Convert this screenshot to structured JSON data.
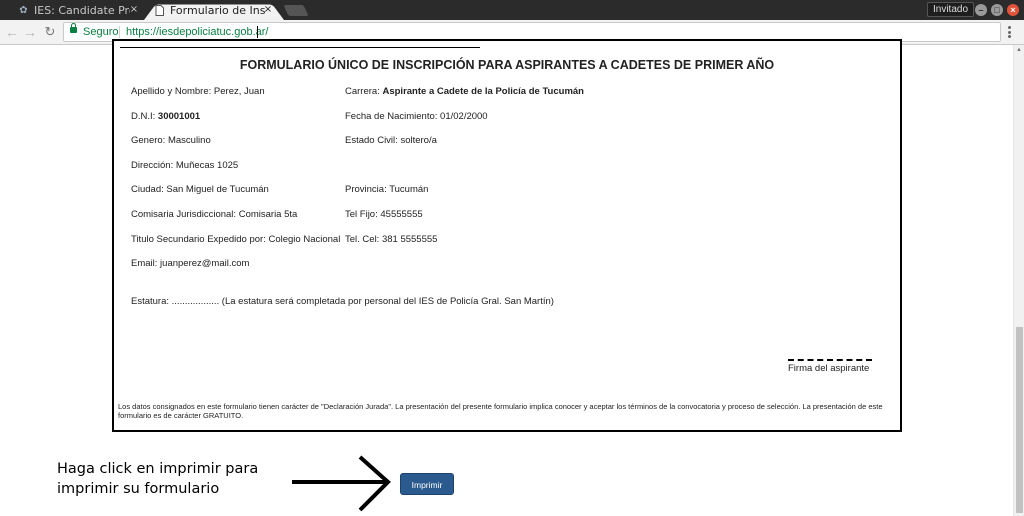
{
  "browser": {
    "tabs": [
      {
        "title": "IES: Candidate Pro",
        "icon": "app-favicon",
        "close": "×"
      },
      {
        "title": "Formulario de Inscr",
        "icon": "document-icon",
        "close": "×"
      }
    ],
    "profile": "Invitado",
    "window_buttons": {
      "minimize": "–",
      "maximize": "□",
      "close": "×"
    },
    "address": {
      "secure_label": "Seguro",
      "url": "https://iesdepoliciatuc.gob.ar/"
    }
  },
  "form": {
    "title": "FORMULARIO ÚNICO DE INSCRIPCIÓN PARA ASPIRANTES A CADETES DE PRIMER AÑO",
    "apellido_label": "Apellido y Nombre: ",
    "apellido_value": "Perez, Juan",
    "carrera_label": "Carrera: ",
    "carrera_value": "Aspirante a Cadete de la Policía de Tucumán",
    "dni_label": "D.N.I: ",
    "dni_value": "30001001",
    "fecha_label": "Fecha de Nacimiento: ",
    "fecha_value": "01/02/2000",
    "genero_label": "Genero: ",
    "genero_value": "Masculino",
    "civil_label": "Estado Civil: ",
    "civil_value": "soltero/a",
    "direccion_label": "Dirección: ",
    "direccion_value": "Muñecas 1025",
    "ciudad_label": "Ciudad: ",
    "ciudad_value": "San Miguel de Tucumán",
    "provincia_label": "Provincia: ",
    "provincia_value": "Tucumán",
    "comisaria_label": "Comisaria Jurisdiccional: ",
    "comisaria_value": "Comisaria 5ta",
    "telfijo_label": "Tel Fijo: ",
    "telfijo_value": "45555555",
    "titulo_label": "Titulo Secundario Expedido por: ",
    "titulo_value": "Colegio Nacional",
    "telcel_label": "Tel. Cel: ",
    "telcel_value": "381 5555555",
    "email_label": "Email: ",
    "email_value": "juanperez@mail.com",
    "estatura_text": "Estatura: .................. (La estatura será completada por personal del IES de Policía Gral. San Martín)",
    "signature_label": "Firma del aspirante",
    "disclaimer": "Los datos consignados en este formulario tienen carácter de \"Declaración Jurada\". La presentación del presente formulario implica conocer y aceptar los términos de la convocatoria y proceso de selección. La presentación de este formulario es de carácter GRATUITO."
  },
  "hint": {
    "line1": "Haga click en imprimir para",
    "line2": "imprimir su formulario"
  },
  "print_button": "Imprimir"
}
